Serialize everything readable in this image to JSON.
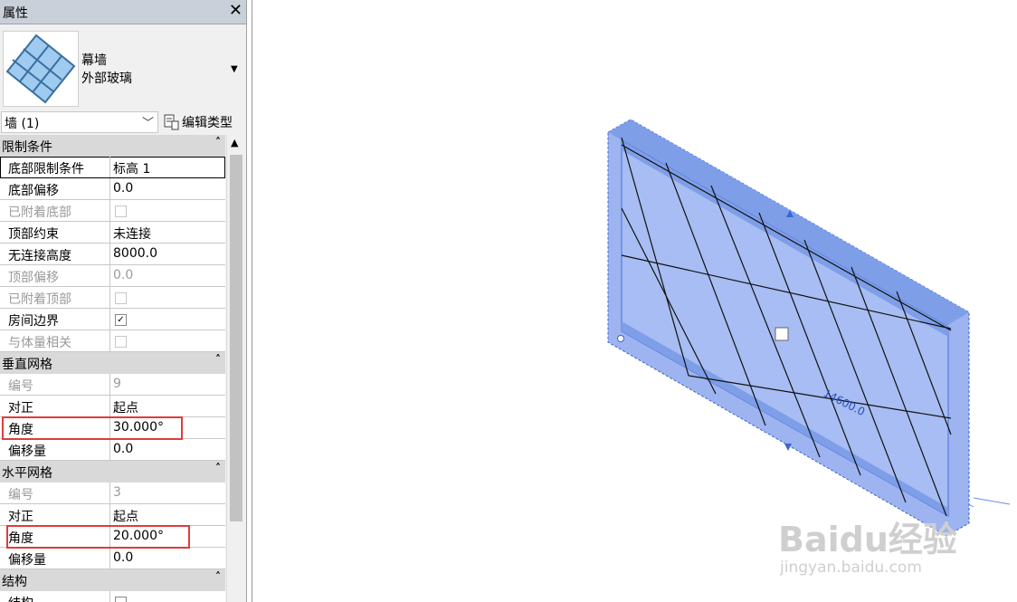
{
  "panel": {
    "title": "属性",
    "close_glyph": "✕",
    "type": {
      "family": "幕墙",
      "name": "外部玻璃",
      "thumbnail_icon": "curtain-wall-icon"
    },
    "filter": {
      "value": "墙 (1)"
    },
    "edit_type_label": "编辑类型"
  },
  "sections": [
    {
      "label": "限制条件",
      "rows": [
        {
          "name": "底部限制条件",
          "value": "标高 1"
        },
        {
          "name": "底部偏移",
          "value": "0.0"
        },
        {
          "name": "已附着底部",
          "checkbox": false,
          "disabled": true
        },
        {
          "name": "顶部约束",
          "value": "未连接"
        },
        {
          "name": "无连接高度",
          "value": "8000.0"
        },
        {
          "name": "顶部偏移",
          "value": "0.0",
          "disabled": true
        },
        {
          "name": "已附着顶部",
          "checkbox": false,
          "disabled": true
        },
        {
          "name": "房间边界",
          "checkbox": true
        },
        {
          "name": "与体量相关",
          "checkbox": false,
          "disabled": true
        }
      ]
    },
    {
      "label": "垂直网格",
      "rows": [
        {
          "name": "编号",
          "value": "9",
          "disabled": true
        },
        {
          "name": "对正",
          "value": "起点"
        },
        {
          "name": "角度",
          "value": "30.000°",
          "highlight": true
        },
        {
          "name": "偏移量",
          "value": "0.0"
        }
      ]
    },
    {
      "label": "水平网格",
      "rows": [
        {
          "name": "编号",
          "value": "3",
          "disabled": true
        },
        {
          "name": "对正",
          "value": "起点"
        },
        {
          "name": "角度",
          "value": "20.000°",
          "highlight": true
        },
        {
          "name": "偏移量",
          "value": "0.0"
        }
      ]
    },
    {
      "label": "结构",
      "rows": [
        {
          "name": "结构",
          "checkbox": false
        }
      ]
    }
  ],
  "view": {
    "dimension_label": "14600.0",
    "watermark_text": "Baidu经验",
    "watermark_url": "jingyan.baidu.com",
    "colors": {
      "wall_fill": "#8eaaf0",
      "frame_fill": "#7e9ee8",
      "highlight": "#e03c3c"
    }
  }
}
